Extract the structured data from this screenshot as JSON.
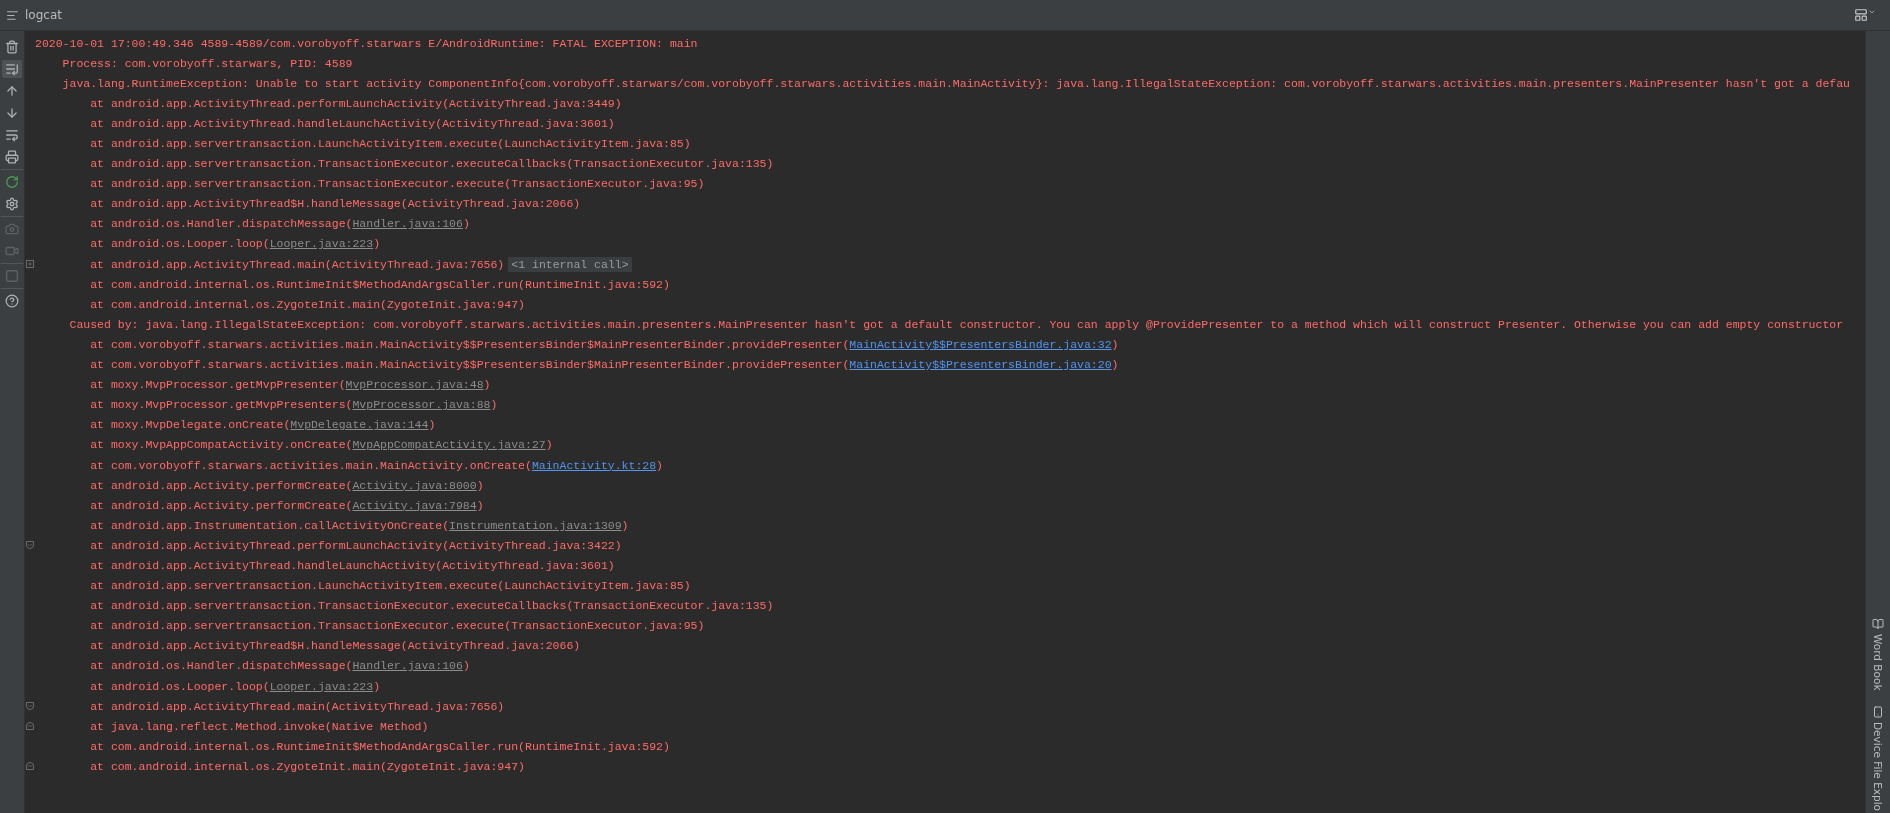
{
  "panel": {
    "title": "logcat"
  },
  "toolbar": [
    [
      {
        "kind": "trash",
        "selected": false,
        "disabled": false
      },
      {
        "kind": "scroll-end",
        "selected": true,
        "disabled": false
      },
      {
        "kind": "up",
        "selected": false,
        "disabled": false
      },
      {
        "kind": "down",
        "selected": false,
        "disabled": false
      },
      {
        "kind": "wrap",
        "selected": false,
        "disabled": false
      },
      {
        "kind": "print",
        "selected": false,
        "disabled": false
      }
    ],
    [
      {
        "kind": "restart",
        "selected": false,
        "disabled": false
      },
      {
        "kind": "settings",
        "selected": false,
        "disabled": false
      }
    ],
    [
      {
        "kind": "camera",
        "selected": false,
        "disabled": true
      },
      {
        "kind": "video",
        "selected": false,
        "disabled": true
      }
    ],
    [
      {
        "kind": "stop",
        "selected": false,
        "disabled": true
      }
    ],
    [
      {
        "kind": "help",
        "selected": false,
        "disabled": false
      }
    ]
  ],
  "log_lines": [
    {
      "kind": "header",
      "text": "2020-10-01 17:00:49.346 4589-4589/com.vorobyoff.starwars E/AndroidRuntime: FATAL EXCEPTION: main"
    },
    {
      "kind": "message",
      "text": "Process: com.vorobyoff.starwars, PID: 4589"
    },
    {
      "kind": "message",
      "text": "java.lang.RuntimeException: Unable to start activity ComponentInfo{com.vorobyoff.starwars/com.vorobyoff.starwars.activities.main.MainActivity}: java.lang.IllegalStateException: com.vorobyoff.starwars.activities.main.presenters.MainPresenter hasn't got a defau"
    },
    {
      "kind": "frame",
      "text": "at android.app.ActivityThread.performLaunchActivity(ActivityThread.java:3449)"
    },
    {
      "kind": "frame",
      "text": "at android.app.ActivityThread.handleLaunchActivity(ActivityThread.java:3601)"
    },
    {
      "kind": "frame",
      "text": "at android.app.servertransaction.LaunchActivityItem.execute(LaunchActivityItem.java:85)"
    },
    {
      "kind": "frame",
      "text": "at android.app.servertransaction.TransactionExecutor.executeCallbacks(TransactionExecutor.java:135)"
    },
    {
      "kind": "frame",
      "text": "at android.app.servertransaction.TransactionExecutor.execute(TransactionExecutor.java:95)"
    },
    {
      "kind": "frame",
      "text": "at android.app.ActivityThread$H.handleMessage(ActivityThread.java:2066)"
    },
    {
      "kind": "frame",
      "text": "at android.os.Handler.dispatchMessage(",
      "link": {
        "text": "Handler.java:106",
        "kind": "library"
      },
      "tail": ")"
    },
    {
      "kind": "frame",
      "text": "at android.os.Looper.loop(",
      "link": {
        "text": "Looper.java:223",
        "kind": "library"
      },
      "tail": ")"
    },
    {
      "kind": "frame",
      "text": "at android.app.ActivityThread.main(ActivityThread.java:7656)",
      "badge": "<1 internal call>",
      "gutter": {
        "kind": "expand"
      }
    },
    {
      "kind": "frame",
      "text": "at com.android.internal.os.RuntimeInit$MethodAndArgsCaller.run(RuntimeInit.java:592)"
    },
    {
      "kind": "frame",
      "text": "at com.android.internal.os.ZygoteInit.main(ZygoteInit.java:947)"
    },
    {
      "kind": "cause",
      "text": "Caused by: java.lang.IllegalStateException: com.vorobyoff.starwars.activities.main.presenters.MainPresenter hasn't got a default constructor. You can apply @ProvidePresenter to a method which will construct Presenter. Otherwise you can add empty constructor"
    },
    {
      "kind": "frame",
      "text": "at com.vorobyoff.starwars.activities.main.MainActivity$$PresentersBinder$MainPresenterBinder.providePresenter(",
      "link": {
        "text": "MainActivity$$PresentersBinder.java:32",
        "kind": "project"
      },
      "tail": ")"
    },
    {
      "kind": "frame",
      "text": "at com.vorobyoff.starwars.activities.main.MainActivity$$PresentersBinder$MainPresenterBinder.providePresenter(",
      "link": {
        "text": "MainActivity$$PresentersBinder.java:20",
        "kind": "project"
      },
      "tail": ")"
    },
    {
      "kind": "frame",
      "text": "at moxy.MvpProcessor.getMvpPresenter(",
      "link": {
        "text": "MvpProcessor.java:48",
        "kind": "library"
      },
      "tail": ")"
    },
    {
      "kind": "frame",
      "text": "at moxy.MvpProcessor.getMvpPresenters(",
      "link": {
        "text": "MvpProcessor.java:88",
        "kind": "library"
      },
      "tail": ")"
    },
    {
      "kind": "frame",
      "text": "at moxy.MvpDelegate.onCreate(",
      "link": {
        "text": "MvpDelegate.java:144",
        "kind": "library"
      },
      "tail": ")"
    },
    {
      "kind": "frame",
      "text": "at moxy.MvpAppCompatActivity.onCreate(",
      "link": {
        "text": "MvpAppCompatActivity.java:27",
        "kind": "library"
      },
      "tail": ")"
    },
    {
      "kind": "frame",
      "text": "at com.vorobyoff.starwars.activities.main.MainActivity.onCreate(",
      "link": {
        "text": "MainActivity.kt:28",
        "kind": "project"
      },
      "tail": ")"
    },
    {
      "kind": "frame",
      "text": "at android.app.Activity.performCreate(",
      "link": {
        "text": "Activity.java:8000",
        "kind": "library"
      },
      "tail": ")"
    },
    {
      "kind": "frame",
      "text": "at android.app.Activity.performCreate(",
      "link": {
        "text": "Activity.java:7984",
        "kind": "library"
      },
      "tail": ")"
    },
    {
      "kind": "frame",
      "text": "at android.app.Instrumentation.callActivityOnCreate(",
      "link": {
        "text": "Instrumentation.java:1309",
        "kind": "library"
      },
      "tail": ")"
    },
    {
      "kind": "frame",
      "text": "at android.app.ActivityThread.performLaunchActivity(ActivityThread.java:3422)",
      "gutter": {
        "kind": "fold-down"
      }
    },
    {
      "kind": "frame",
      "text": "at android.app.ActivityThread.handleLaunchActivity(ActivityThread.java:3601)"
    },
    {
      "kind": "frame",
      "text": "at android.app.servertransaction.LaunchActivityItem.execute(LaunchActivityItem.java:85)"
    },
    {
      "kind": "frame",
      "text": "at android.app.servertransaction.TransactionExecutor.executeCallbacks(TransactionExecutor.java:135)"
    },
    {
      "kind": "frame",
      "text": "at android.app.servertransaction.TransactionExecutor.execute(TransactionExecutor.java:95)"
    },
    {
      "kind": "frame",
      "text": "at android.app.ActivityThread$H.handleMessage(ActivityThread.java:2066)"
    },
    {
      "kind": "frame",
      "text": "at android.os.Handler.dispatchMessage(",
      "link": {
        "text": "Handler.java:106",
        "kind": "library"
      },
      "tail": ")"
    },
    {
      "kind": "frame",
      "text": "at android.os.Looper.loop(",
      "link": {
        "text": "Looper.java:223",
        "kind": "library"
      },
      "tail": ")"
    },
    {
      "kind": "frame",
      "text": "at android.app.ActivityThread.main(ActivityThread.java:7656)",
      "gutter": {
        "kind": "fold-down"
      }
    },
    {
      "kind": "frame",
      "text": "at java.lang.reflect.Method.invoke(Native Method)",
      "gutter": {
        "kind": "fold-up"
      }
    },
    {
      "kind": "frame",
      "text": "at com.android.internal.os.RuntimeInit$MethodAndArgsCaller.run(RuntimeInit.java:592)"
    },
    {
      "kind": "frame",
      "text": "at com.android.internal.os.ZygoteInit.main(ZygoteInit.java:947)",
      "gutter": {
        "kind": "fold-up"
      }
    }
  ],
  "side_tabs": [
    {
      "kind": "book",
      "label": "Word Book"
    },
    {
      "kind": "device",
      "label": "Device File Explo"
    }
  ]
}
